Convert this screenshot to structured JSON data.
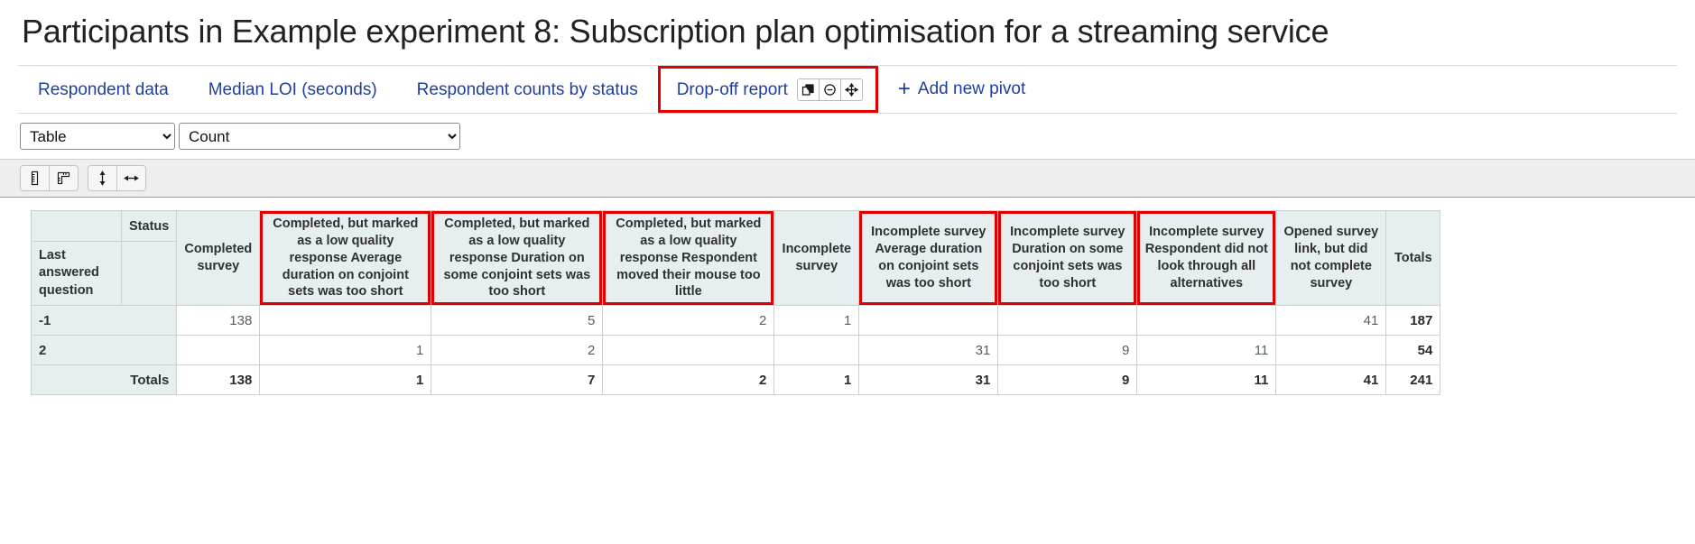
{
  "header": {
    "title": "Participants in Example experiment 8: Subscription plan optimisation for a streaming service"
  },
  "tabs": [
    {
      "label": "Respondent data",
      "active": false
    },
    {
      "label": "Median LOI (seconds)",
      "active": false
    },
    {
      "label": "Respondent counts by status",
      "active": false
    },
    {
      "label": "Drop-off report",
      "active": true
    }
  ],
  "tab_icons": [
    {
      "name": "duplicate-icon",
      "title": "Duplicate pivot"
    },
    {
      "name": "remove-circle-icon",
      "title": "Remove pivot"
    },
    {
      "name": "move-icon",
      "title": "Move pivot"
    }
  ],
  "add_pivot": {
    "plus": "+",
    "label": "Add new pivot"
  },
  "controls": {
    "view_select": {
      "value": "Table",
      "options": [
        "Table"
      ]
    },
    "metric_select": {
      "value": "Count",
      "options": [
        "Count"
      ]
    }
  },
  "toolbar": [
    {
      "name": "column-ruler-icon",
      "title": "Column sizing"
    },
    {
      "name": "row-ruler-icon",
      "title": "Row sizing"
    },
    {
      "name": "fit-height-icon",
      "title": "Fit height"
    },
    {
      "name": "fit-width-icon",
      "title": "Fit width"
    }
  ],
  "table": {
    "corner_top": "Status",
    "corner_left": "Last answered question",
    "columns": [
      {
        "label": "Completed survey",
        "highlight": false,
        "width": "w-comp"
      },
      {
        "label": "Completed, but marked as a low quality response Average duration on conjoint sets was too short",
        "highlight": true,
        "width": "w-long"
      },
      {
        "label": "Completed, but marked as a low quality response Duration on some conjoint sets was too short",
        "highlight": true,
        "width": "w-long"
      },
      {
        "label": "Completed, but marked as a low quality response Respondent moved their mouse too little",
        "highlight": true,
        "width": "w-long"
      },
      {
        "label": "Incomplete survey",
        "highlight": false,
        "width": "w-inc"
      },
      {
        "label": "Incomplete survey Average duration on conjoint sets was too short",
        "highlight": true,
        "width": "w-inc2"
      },
      {
        "label": "Incomplete survey Duration on some conjoint sets was too short",
        "highlight": true,
        "width": "w-inc2"
      },
      {
        "label": "Incomplete survey Respondent did not look through all alternatives",
        "highlight": true,
        "width": "w-inc2"
      },
      {
        "label": "Opened survey link, but did not complete survey",
        "highlight": false,
        "width": "w-open"
      },
      {
        "label": "Totals",
        "highlight": false,
        "width": "w-tot"
      }
    ],
    "rows": [
      {
        "label": "-1",
        "label_align": "left",
        "totals_row": false,
        "values": [
          "138",
          "",
          "5",
          "2",
          "1",
          "",
          "",
          "",
          "41",
          "187"
        ]
      },
      {
        "label": "2",
        "label_align": "left",
        "totals_row": false,
        "values": [
          "",
          "1",
          "2",
          "",
          "",
          "31",
          "9",
          "11",
          "",
          "54"
        ]
      },
      {
        "label": "Totals",
        "label_align": "right",
        "totals_row": true,
        "values": [
          "138",
          "1",
          "7",
          "2",
          "1",
          "31",
          "9",
          "11",
          "41",
          "241"
        ]
      }
    ]
  },
  "colors": {
    "link": "#1f3fa0",
    "highlight": "#e00000",
    "header_bg": "#e7eeef",
    "toolbar_bg": "#eeeeee"
  }
}
